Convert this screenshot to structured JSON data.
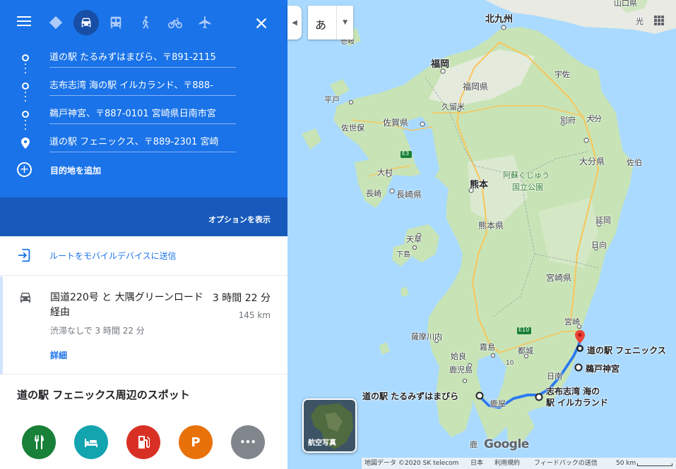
{
  "header": {
    "modes": [
      {
        "name": "best-route-icon"
      },
      {
        "name": "car-icon",
        "active": true
      },
      {
        "name": "transit-icon"
      },
      {
        "name": "walk-icon"
      },
      {
        "name": "bicycle-icon"
      },
      {
        "name": "flight-icon"
      }
    ],
    "close_icon": "close-icon",
    "menu_icon": "menu-icon"
  },
  "waypoints": [
    {
      "value": "道の駅 たるみずはまびら、〒891-2115"
    },
    {
      "value": "志布志湾 海の駅 イルカランド、〒888-"
    },
    {
      "value": "鵜戸神宮、〒887-0101 宮崎県日南市宮"
    },
    {
      "value": "道の駅 フェニックス、〒889-2301 宮崎"
    }
  ],
  "add_destination": "目的地を追加",
  "options_label": "オプションを表示",
  "send_to_mobile": "ルートをモバイルデバイスに送信",
  "route": {
    "via": "国道220号 と 大隅グリーンロード 経由",
    "duration": "3 時間 22 分",
    "distance": "145 km",
    "traffic": "渋滞なしで 3 時間 22 分",
    "details": "詳細"
  },
  "nearby": {
    "title": "道の駅 フェニックス周辺のスポット",
    "buttons": [
      {
        "name": "restaurant-icon",
        "color": "#188038"
      },
      {
        "name": "hotel-icon",
        "color": "#12a4af"
      },
      {
        "name": "gas-station-icon",
        "color": "#d93025"
      },
      {
        "name": "parking-icon",
        "label": "P",
        "color": "#e8710a"
      },
      {
        "name": "more-icon",
        "label": "•••",
        "color": "#80868b"
      }
    ]
  },
  "map": {
    "ime_label": "あ",
    "satellite_label": "航空写真",
    "labels": {
      "kitakyushu": "北九州",
      "yamaguchi": "山口県",
      "hikari": "光",
      "iki": "壱岐",
      "fukuoka_city": "福岡",
      "fukuoka_pref": "福岡県",
      "usa": "宇佐",
      "hirado": "平戸",
      "kurume": "久留米",
      "oita_city": "大分",
      "beppu": "別府",
      "saga": "佐賀県",
      "sasebo": "佐世保",
      "e3": "E3",
      "omura": "大村",
      "nagasaki_city": "長崎",
      "nagasaki_pref": "長崎県",
      "kumamoto_city": "熊本",
      "aso": "阿蘇くじゅう",
      "aso2": "国立公園",
      "oita_pref": "大分県",
      "saiki": "佐伯",
      "amakusa": "天草",
      "shimoshima": "下島",
      "kumamoto_pref": "熊本県",
      "nobeoka": "延岡",
      "hyuga": "日向",
      "miyazaki_pref": "宮崎県",
      "satsumasendai": "薩摩川内",
      "miyazaki_city": "宮崎",
      "e10": "E10",
      "kirishima": "霧島",
      "miyakonojo": "都城",
      "aira": "姶良",
      "kagoshima": "鹿児島",
      "r10": "10",
      "nichinan": "日南",
      "kanoya": "鹿屋",
      "marker_phoenix": "道の駅 フェニックス",
      "marker_udo": "鵜戸神宮",
      "marker_shibushi1": "志布志湾 海の",
      "marker_shibushi2": "駅 イルカランド",
      "marker_tarumizu": "道の駅 たるみずはまびら",
      "kago_small": "鹿",
      "google": "Google"
    },
    "footer": {
      "map_data": "地図データ ©2020 SK telecom",
      "country": "日本",
      "terms": "利用規約",
      "feedback": "フィードバックの送信",
      "scale": "50 km"
    }
  },
  "colors": {
    "header_blue": "#1a73e8",
    "options_blue": "#185abc",
    "route_blue": "#4285f4",
    "pin_red": "#ea4335"
  }
}
